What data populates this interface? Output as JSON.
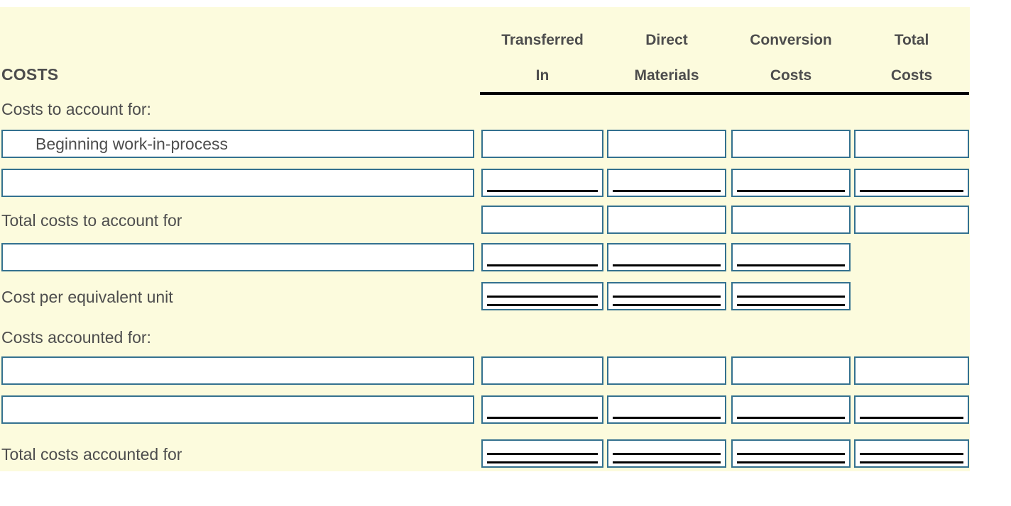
{
  "panel": {
    "background_color": "#fcfbdd",
    "box_border_color": "#34718f",
    "text_color": "#4d4d4d",
    "rule_color": "#000000"
  },
  "header": {
    "section_title": "COSTS",
    "columns": [
      {
        "line1": "Transferred",
        "line2": "In"
      },
      {
        "line1": "Direct",
        "line2": "Materials"
      },
      {
        "line1": "Conversion",
        "line2": "Costs"
      },
      {
        "line1": "Total",
        "line2": "Costs"
      }
    ]
  },
  "rows": [
    {
      "kind": "section-label",
      "label": "Costs to account for:"
    },
    {
      "kind": "input-row",
      "label_box_value": "Beginning work-in-process",
      "label_box_placeholder": "",
      "cells": [
        {
          "value": "",
          "rule": "none"
        },
        {
          "value": "",
          "rule": "none"
        },
        {
          "value": "",
          "rule": "none"
        },
        {
          "value": "",
          "rule": "none"
        }
      ]
    },
    {
      "kind": "input-row",
      "label_box_value": "",
      "label_box_placeholder": "",
      "cells": [
        {
          "value": "",
          "rule": "single"
        },
        {
          "value": "",
          "rule": "single"
        },
        {
          "value": "",
          "rule": "single"
        },
        {
          "value": "",
          "rule": "single"
        }
      ]
    },
    {
      "kind": "total-label",
      "label": "Total costs to account for",
      "cells": [
        {
          "value": "",
          "rule": "none"
        },
        {
          "value": "",
          "rule": "none"
        },
        {
          "value": "",
          "rule": "none"
        },
        {
          "value": "",
          "rule": "none"
        }
      ]
    },
    {
      "kind": "input-row",
      "label_box_value": "",
      "label_box_placeholder": "",
      "cells": [
        {
          "value": "",
          "rule": "single"
        },
        {
          "value": "",
          "rule": "single"
        },
        {
          "value": "",
          "rule": "single"
        }
      ]
    },
    {
      "kind": "total-label",
      "label": "Cost per equivalent unit",
      "cells": [
        {
          "value": "",
          "rule": "double"
        },
        {
          "value": "",
          "rule": "double"
        },
        {
          "value": "",
          "rule": "double"
        }
      ]
    },
    {
      "kind": "section-label",
      "label": "Costs accounted for:"
    },
    {
      "kind": "input-row",
      "label_box_value": "",
      "label_box_placeholder": "",
      "cells": [
        {
          "value": "",
          "rule": "none"
        },
        {
          "value": "",
          "rule": "none"
        },
        {
          "value": "",
          "rule": "none"
        },
        {
          "value": "",
          "rule": "none"
        }
      ]
    },
    {
      "kind": "input-row",
      "label_box_value": "",
      "label_box_placeholder": "",
      "cells": [
        {
          "value": "",
          "rule": "single"
        },
        {
          "value": "",
          "rule": "single"
        },
        {
          "value": "",
          "rule": "single"
        },
        {
          "value": "",
          "rule": "single"
        }
      ]
    },
    {
      "kind": "total-label",
      "label": "Total costs accounted for",
      "cells": [
        {
          "value": "",
          "rule": "double"
        },
        {
          "value": "",
          "rule": "double"
        },
        {
          "value": "",
          "rule": "double"
        },
        {
          "value": "",
          "rule": "double"
        }
      ]
    }
  ]
}
